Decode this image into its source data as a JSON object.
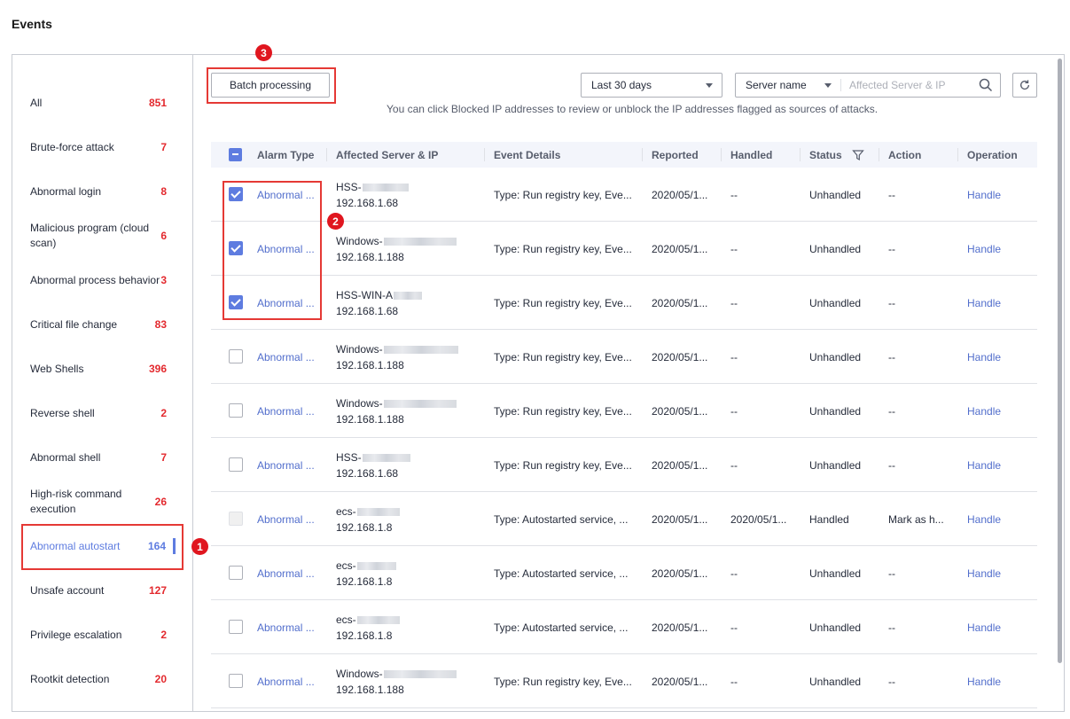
{
  "page_title": "Events",
  "sidebar": {
    "items": [
      {
        "label": "All",
        "count": "851"
      },
      {
        "label": "Brute-force attack",
        "count": "7"
      },
      {
        "label": "Abnormal login",
        "count": "8"
      },
      {
        "label": "Malicious program (cloud scan)",
        "count": "6"
      },
      {
        "label": "Abnormal process behavior",
        "count": "3"
      },
      {
        "label": "Critical file change",
        "count": "83"
      },
      {
        "label": "Web Shells",
        "count": "396"
      },
      {
        "label": "Reverse shell",
        "count": "2"
      },
      {
        "label": "Abnormal shell",
        "count": "7"
      },
      {
        "label": "High-risk command execution",
        "count": "26"
      },
      {
        "label": "Abnormal autostart",
        "count": "164"
      },
      {
        "label": "Unsafe account",
        "count": "127"
      },
      {
        "label": "Privilege escalation",
        "count": "2"
      },
      {
        "label": "Rootkit detection",
        "count": "20"
      }
    ],
    "active_index": 10
  },
  "toolbar": {
    "batch_label": "Batch processing",
    "time_filter": "Last 30 days",
    "search_type": "Server name",
    "search_placeholder": "Affected Server & IP",
    "hint": "You can click Blocked IP addresses to review or unblock the IP addresses flagged as sources of attacks."
  },
  "table": {
    "headers": {
      "alarm_type": "Alarm Type",
      "server": "Affected Server & IP",
      "details": "Event Details",
      "reported": "Reported",
      "handled": "Handled",
      "status": "Status",
      "action": "Action",
      "operation": "Operation"
    },
    "rows": [
      {
        "checked": true,
        "disabled": false,
        "alarm_type": "Abnormal ...",
        "server": "HSS-",
        "ip": "192.168.1.68",
        "details": "Type: Run registry key, Eve...",
        "reported": "2020/05/1...",
        "handled": "--",
        "status": "Unhandled",
        "action": "--",
        "operation": "Handle"
      },
      {
        "checked": true,
        "disabled": false,
        "alarm_type": "Abnormal ...",
        "server": "Windows-",
        "ip": "192.168.1.188",
        "details": "Type: Run registry key, Eve...",
        "reported": "2020/05/1...",
        "handled": "--",
        "status": "Unhandled",
        "action": "--",
        "operation": "Handle"
      },
      {
        "checked": true,
        "disabled": false,
        "alarm_type": "Abnormal ...",
        "server": "HSS-WIN-A",
        "ip": "192.168.1.68",
        "details": "Type: Run registry key, Eve...",
        "reported": "2020/05/1...",
        "handled": "--",
        "status": "Unhandled",
        "action": "--",
        "operation": "Handle"
      },
      {
        "checked": false,
        "disabled": false,
        "alarm_type": "Abnormal ...",
        "server": "Windows-",
        "ip": "192.168.1.188",
        "details": "Type: Run registry key, Eve...",
        "reported": "2020/05/1...",
        "handled": "--",
        "status": "Unhandled",
        "action": "--",
        "operation": "Handle"
      },
      {
        "checked": false,
        "disabled": false,
        "alarm_type": "Abnormal ...",
        "server": "Windows-",
        "ip": "192.168.1.188",
        "details": "Type: Run registry key, Eve...",
        "reported": "2020/05/1...",
        "handled": "--",
        "status": "Unhandled",
        "action": "--",
        "operation": "Handle"
      },
      {
        "checked": false,
        "disabled": false,
        "alarm_type": "Abnormal ...",
        "server": "HSS-",
        "ip": "192.168.1.68",
        "details": "Type: Run registry key, Eve...",
        "reported": "2020/05/1...",
        "handled": "--",
        "status": "Unhandled",
        "action": "--",
        "operation": "Handle"
      },
      {
        "checked": false,
        "disabled": true,
        "alarm_type": "Abnormal ...",
        "server": "ecs-",
        "ip": "192.168.1.8",
        "details": "Type: Autostarted service, ...",
        "reported": "2020/05/1...",
        "handled": "2020/05/1...",
        "status": "Handled",
        "action": "Mark as h...",
        "operation": "Handle"
      },
      {
        "checked": false,
        "disabled": false,
        "alarm_type": "Abnormal ...",
        "server": "ecs-",
        "ip": "192.168.1.8",
        "details": "Type: Autostarted service, ...",
        "reported": "2020/05/1...",
        "handled": "--",
        "status": "Unhandled",
        "action": "--",
        "operation": "Handle"
      },
      {
        "checked": false,
        "disabled": false,
        "alarm_type": "Abnormal ...",
        "server": "ecs-",
        "ip": "192.168.1.8",
        "details": "Type: Autostarted service, ...",
        "reported": "2020/05/1...",
        "handled": "--",
        "status": "Unhandled",
        "action": "--",
        "operation": "Handle"
      },
      {
        "checked": false,
        "disabled": false,
        "alarm_type": "Abnormal ...",
        "server": "Windows-",
        "ip": "192.168.1.188",
        "details": "Type: Run registry key, Eve...",
        "reported": "2020/05/1...",
        "handled": "--",
        "status": "Unhandled",
        "action": "--",
        "operation": "Handle"
      }
    ]
  },
  "annotations": [
    "1",
    "2",
    "3"
  ],
  "colors": {
    "accent": "#5e7ce0",
    "count": "#e3292e",
    "annotation": "#e0161f"
  },
  "icons": [
    "search-icon",
    "refresh-icon",
    "filter-icon",
    "chevron-down-icon",
    "checkbox-icon"
  ]
}
